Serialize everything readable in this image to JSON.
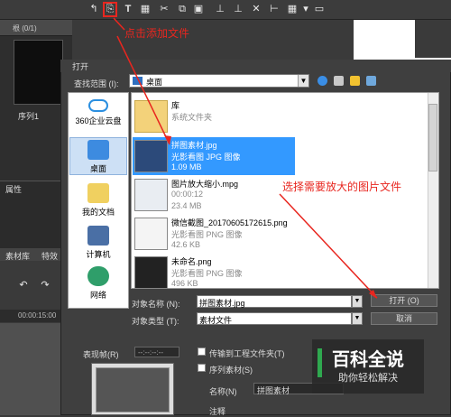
{
  "editor": {
    "bin_title": "根 (0/1)",
    "sequence_label": "序列1",
    "properties_label": "属性",
    "tabs": [
      "素材库",
      "特效"
    ],
    "timecode": "00:00:15:00"
  },
  "dialog": {
    "title": "打开",
    "look_in_label": "查找范围 (I):",
    "look_in_value": "桌面",
    "places": [
      {
        "label": "360企业云盘",
        "icon": "cloud-icon"
      },
      {
        "label": "桌面",
        "icon": "desktop-icon"
      },
      {
        "label": "我的文档",
        "icon": "documents-icon"
      },
      {
        "label": "计算机",
        "icon": "computer-icon"
      },
      {
        "label": "网络",
        "icon": "network-icon"
      }
    ],
    "files": [
      {
        "name": "库",
        "type": "系统文件夹",
        "size": ""
      },
      {
        "name": "拼图素材.jpg",
        "type": "光影看图 JPG 图像",
        "size": "1.09 MB"
      },
      {
        "name": "图片放大缩小.mpg",
        "type": "00:00:12",
        "size": "23.4 MB"
      },
      {
        "name": "微信截图_20170605172615.png",
        "type": "光影看图 PNG 图像",
        "size": "42.6 KB"
      },
      {
        "name": "未命名.png",
        "type": "光影看图 PNG 图像",
        "size": "496 KB"
      }
    ],
    "filename_label": "对象名称 (N):",
    "filename_value": "拼图素材.jpg",
    "filetype_label": "对象类型 (T):",
    "filetype_value": "素材文件",
    "open_button": "打开 (O)",
    "cancel_button": "取消",
    "preview_label": "表现帧(R)",
    "preview_time": "--:--:--:--",
    "option_transfer": "传输到工程文件夹(T)",
    "option_sequence": "序列素材(S)",
    "name_label": "名称(N)",
    "name_value": "拼图素材",
    "comment_label": "注释"
  },
  "annotations": {
    "click_add": "点击添加文件",
    "choose_image": "选择需要放大的图片文件"
  },
  "watermark": {
    "title": "百科全说",
    "subtitle": "助你轻松解决"
  },
  "colors": {
    "annotation": "#e8261f",
    "selection": "#3399ff",
    "watermark_green": "#2fa84f"
  }
}
